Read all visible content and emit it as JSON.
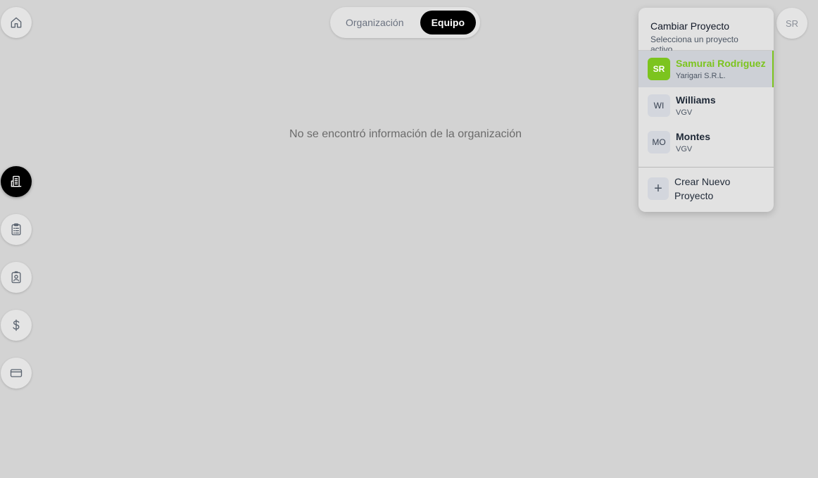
{
  "nav": {
    "home_icon": "home-icon",
    "side_items": [
      {
        "icon": "building-icon",
        "active": true
      },
      {
        "icon": "clipboard-list-icon",
        "active": false
      },
      {
        "icon": "contact-badge-icon",
        "active": false
      },
      {
        "icon": "dollar-icon",
        "active": false
      },
      {
        "icon": "credit-card-icon",
        "active": false
      }
    ]
  },
  "tabs": {
    "organization": "Organización",
    "team": "Equipo",
    "active": "Equipo"
  },
  "main": {
    "empty_message": "No se encontró información de la organización"
  },
  "user": {
    "initials": "SR"
  },
  "project_switcher": {
    "title": "Cambiar Proyecto",
    "subtitle": "Selecciona un proyecto activo",
    "projects": [
      {
        "initials": "SR",
        "name": "Samurai Rodriguez",
        "org": "Yarigari S.R.L.",
        "active": true
      },
      {
        "initials": "WI",
        "name": "Williams",
        "org": "VGV",
        "active": false
      },
      {
        "initials": "MO",
        "name": "Montes",
        "org": "VGV",
        "active": false
      }
    ],
    "create_icon": "+",
    "create_label": "Crear Nuevo Proyecto"
  },
  "colors": {
    "accent": "#7cc41e",
    "background": "#d3d3d3",
    "active_nav": "#000000"
  }
}
